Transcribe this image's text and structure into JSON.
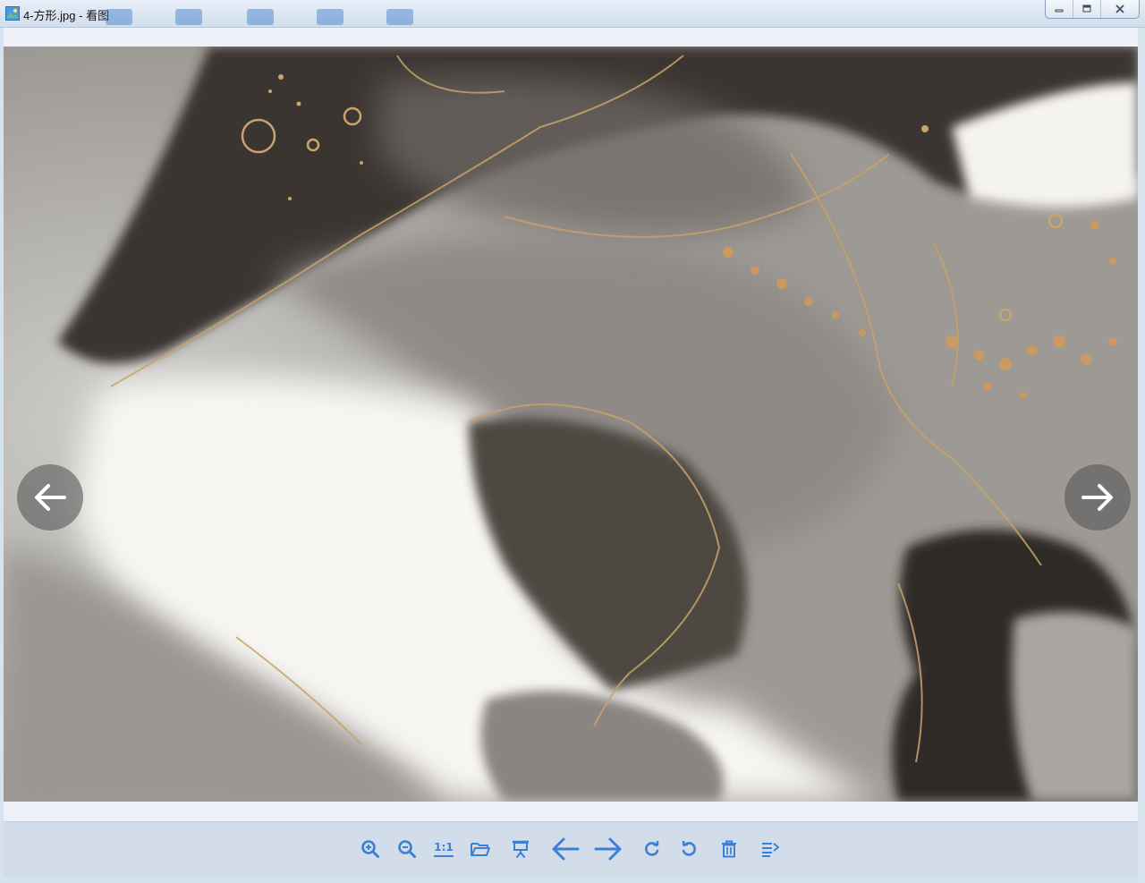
{
  "window": {
    "title": "4-方形.jpg - 看图"
  },
  "toolbar": {
    "zoom_in": "zoom-in-icon",
    "zoom_out": "zoom-out-icon",
    "actual_size_label": "1:1",
    "open_folder": "folder-open-icon",
    "slideshow": "slideshow-icon",
    "previous": "arrow-left-icon",
    "next": "arrow-right-icon",
    "rotate_right": "rotate-clockwise-icon",
    "rotate_left": "rotate-counterclockwise-icon",
    "delete": "trash-icon",
    "menu": "menu-list-icon"
  },
  "colors": {
    "accent": "#3c7fd6",
    "toolbar_bg": "#d3dde9",
    "title_bg": "#dce6f1"
  }
}
